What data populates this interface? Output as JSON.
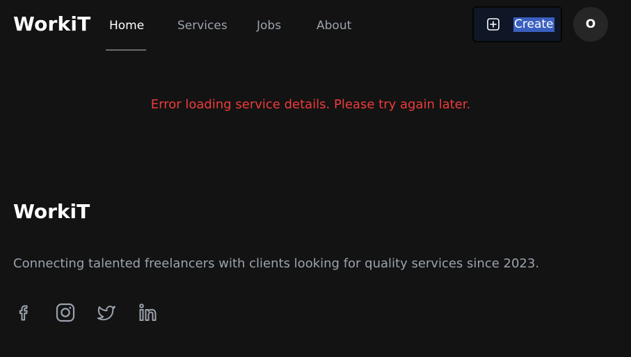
{
  "header": {
    "logo": "WorkiT",
    "nav": [
      {
        "label": "Home",
        "active": true
      },
      {
        "label": "Services",
        "active": false
      },
      {
        "label": "Jobs",
        "active": false
      },
      {
        "label": "About",
        "active": false
      }
    ],
    "create_label": "Create",
    "avatar_initial": "O"
  },
  "main": {
    "error_message": "Error loading service details. Please try again later."
  },
  "footer": {
    "logo": "WorkiT",
    "tagline": "Connecting talented freelancers with clients looking for quality services since 2023.",
    "social_icons": [
      "facebook-icon",
      "instagram-icon",
      "twitter-icon",
      "linkedin-icon"
    ]
  },
  "colors": {
    "background": "#131313",
    "error": "#ef3b3b",
    "muted_text": "#9ca3af",
    "create_button_bg": "#0f1626",
    "avatar_bg": "#262626"
  }
}
